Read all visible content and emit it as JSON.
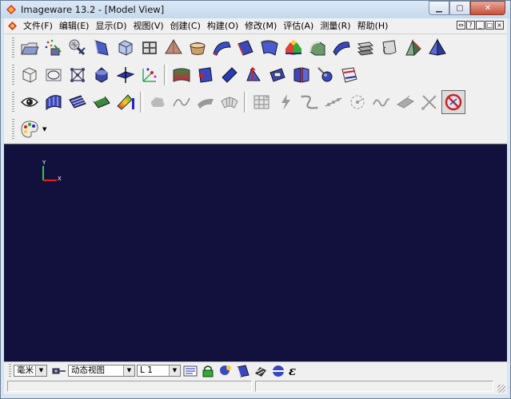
{
  "window": {
    "title": "Imageware 13.2  - [Model View]",
    "controls": [
      "minimize-icon",
      "maximize-icon",
      "close-icon"
    ]
  },
  "menubar": {
    "items": [
      {
        "label": "文件(F)"
      },
      {
        "label": "编辑(E)"
      },
      {
        "label": "显示(D)"
      },
      {
        "label": "视图(V)"
      },
      {
        "label": "创建(C)"
      },
      {
        "label": "构建(O)"
      },
      {
        "label": "修改(M)"
      },
      {
        "label": "评估(A)"
      },
      {
        "label": "测量(R)"
      },
      {
        "label": "帮助(H)"
      }
    ],
    "mdi_controls": [
      "⇔",
      "?",
      "_",
      "□",
      "×"
    ]
  },
  "toolbars": {
    "row1": [
      "open-file-icon",
      "import-points-icon",
      "cloud-scan-icon",
      "curve-surface-icon",
      "box-view-icon",
      "mesh-grid-icon",
      "cone-surface-icon",
      "tube-surface-icon",
      "blend-surface-icon",
      "offset-surface-icon",
      "sweep-surface-icon",
      "multi-color-surface-icon",
      "fillet-surface-icon",
      "curved-sheet-icon",
      "stack-surfaces-icon",
      "roll-surface-icon",
      "triangle-surface-icon",
      "pyramid-icon"
    ],
    "row2": [
      "wire-box-icon",
      "circle-frame-icon",
      "node-network-icon",
      "solid-sphere-icon",
      "plane-cross-icon",
      "point-axis-icon",
      "gradient-surface-icon",
      "flip-surface-icon",
      "tilt-surface-icon",
      "arrow-surface-icon",
      "loop-surface-icon",
      "panel-surface-icon",
      "ball-tool-icon",
      "cut-surface-icon"
    ],
    "row3": [
      "eye-view-icon",
      "curvature-surface-icon",
      "stripe-surface-icon",
      "green-strip-icon",
      "color-map-icon",
      "cloud-gray-icon",
      "curve-gray-icon",
      "patch-gray-icon",
      "fan-gray-icon",
      "grid-gray-icon",
      "lightning-gray-icon",
      "spline-gray-icon",
      "points-line-gray-icon",
      "circle-dash-gray-icon",
      "wave-gray-icon",
      "sheet-gray-icon",
      "cross-gray-icon",
      "no-entry-icon"
    ],
    "row4": [
      "palette-icon"
    ]
  },
  "viewport": {
    "background": "#12113e",
    "axis_labels": {
      "y": "Y",
      "x": "X"
    }
  },
  "bottom_bar": {
    "unit": "毫米",
    "view_mode": "动态视图",
    "layer": "L 1",
    "epsilon_label": "ε"
  },
  "status_bar": {
    "pane1": "",
    "pane2": ""
  }
}
